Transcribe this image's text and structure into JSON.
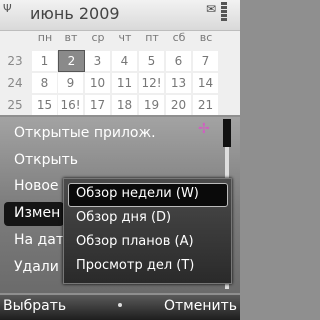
{
  "status": {
    "month_year": "июнь 2009"
  },
  "calendar": {
    "weekdays": [
      "пн",
      "вт",
      "ср",
      "чт",
      "пт",
      "сб",
      "вс"
    ],
    "rows": [
      {
        "week": "23",
        "days": [
          "1",
          "2",
          "3",
          "4",
          "5",
          "6",
          "7"
        ]
      },
      {
        "week": "24",
        "days": [
          "8",
          "9",
          "10",
          "11",
          "12!",
          "13",
          "14"
        ]
      },
      {
        "week": "25",
        "days": [
          "15",
          "16!",
          "17",
          "18",
          "19",
          "20",
          "21"
        ]
      }
    ],
    "today_index": [
      0,
      1
    ]
  },
  "menu": {
    "items": [
      "Открытые прилож.",
      "Открыть",
      "Новое",
      "Измен",
      "На дат",
      "Удали"
    ],
    "highlighted": 3
  },
  "submenu": {
    "items": [
      "Обзор недели (W)",
      "Обзор дня (D)",
      "Обзор планов (A)",
      "Просмотр дел (T)"
    ],
    "highlighted": 0
  },
  "softkeys": {
    "left": "Выбрать",
    "right": "Отменить"
  },
  "colors": {
    "highlight": "#0a0a0a",
    "menu_text": "#ffffff",
    "accent_icon": "#cf60c0"
  }
}
